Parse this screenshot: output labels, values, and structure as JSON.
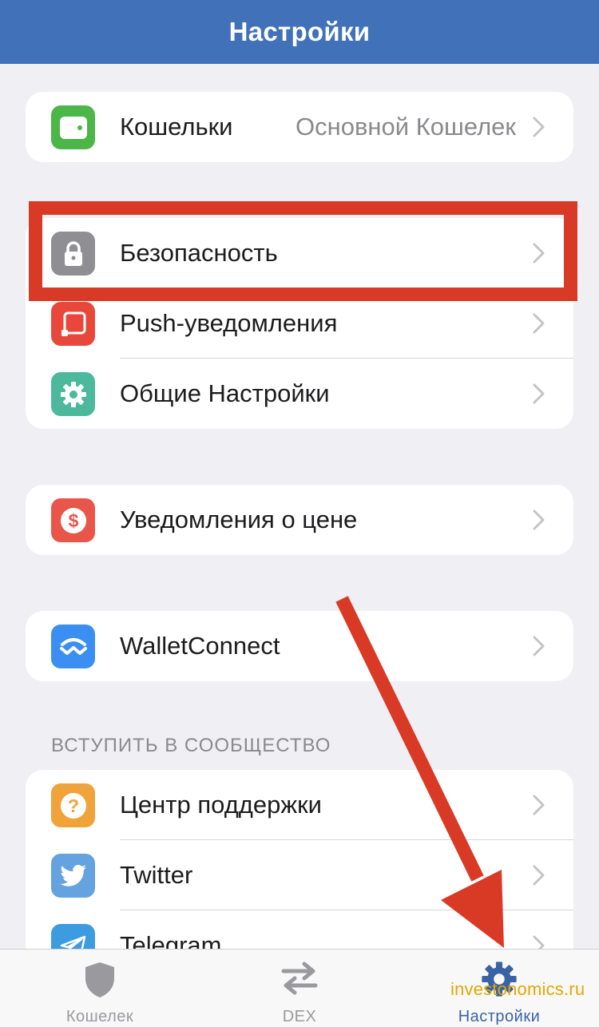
{
  "header": {
    "title": "Настройки"
  },
  "wallets": {
    "label": "Кошельки",
    "value": "Основной Кошелек"
  },
  "security_group": {
    "items": [
      {
        "label": "Безопасность"
      },
      {
        "label": "Push-уведомления"
      },
      {
        "label": "Общие Настройки"
      }
    ]
  },
  "price_alerts": {
    "label": "Уведомления о цене"
  },
  "walletconnect": {
    "label": "WalletConnect"
  },
  "community": {
    "header": "ВСТУПИТЬ В СООБЩЕСТВО",
    "items": [
      {
        "label": "Центр поддержки"
      },
      {
        "label": "Twitter"
      },
      {
        "label": "Telegram"
      }
    ]
  },
  "tabbar": {
    "tabs": [
      {
        "label": "Кошелек",
        "icon": "shield-icon"
      },
      {
        "label": "DEX",
        "icon": "swap-arrows-icon"
      },
      {
        "label": "Настройки",
        "icon": "gear-icon",
        "active": true
      }
    ]
  },
  "watermark": "investonomics.ru",
  "colors": {
    "header": "#4171b9",
    "highlight": "#d93a26",
    "active_tab": "#3a63a6"
  }
}
